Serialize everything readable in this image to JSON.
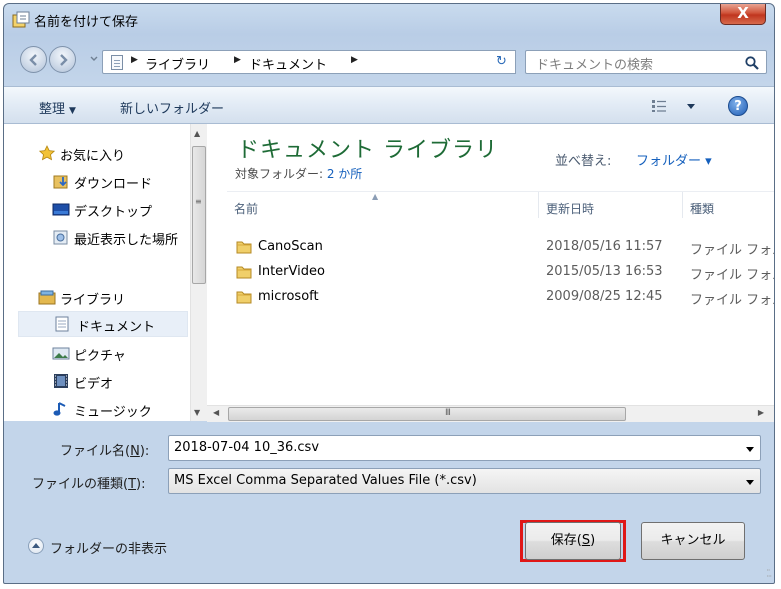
{
  "window": {
    "title": "名前を付けて保存",
    "close_glyph": "X"
  },
  "address": {
    "crumbs": [
      "ライブラリ",
      "ドキュメント"
    ],
    "search_placeholder": "ドキュメントの検索"
  },
  "toolbar": {
    "organize": "整理",
    "new_folder": "新しいフォルダー"
  },
  "navpane": {
    "items": [
      {
        "label": "お気に入り",
        "icon": "star-icon"
      },
      {
        "label": "ダウンロード",
        "icon": "download-folder-icon"
      },
      {
        "label": "デスクトップ",
        "icon": "desktop-icon"
      },
      {
        "label": "最近表示した場所",
        "icon": "recent-places-icon"
      },
      {
        "label": "ライブラリ",
        "icon": "library-icon"
      },
      {
        "label": "ドキュメント",
        "icon": "document-icon"
      },
      {
        "label": "ピクチャ",
        "icon": "picture-icon"
      },
      {
        "label": "ビデオ",
        "icon": "video-icon"
      },
      {
        "label": "ミュージック",
        "icon": "music-icon"
      }
    ]
  },
  "content": {
    "library_title": "ドキュメント ライブラリ",
    "target_prefix": "対象フォルダー: ",
    "target_count": "2 か所",
    "sort_label": "並べ替え:",
    "sort_value": "フォルダー ▾",
    "columns": [
      "名前",
      "更新日時",
      "種類"
    ],
    "files": [
      {
        "name": "CanoScan",
        "modified": "2018/05/16 11:57",
        "type": "ファイル フォルダー"
      },
      {
        "name": "InterVideo",
        "modified": "2015/05/13 16:53",
        "type": "ファイル フォルダー"
      },
      {
        "name": "microsoft",
        "modified": "2009/08/25 12:45",
        "type": "ファイル フォルダー"
      }
    ]
  },
  "form": {
    "filename_label": "ファイル名(",
    "filename_key": "N",
    "filename_tail": "):",
    "filename_value": "2018-07-04 10_36.csv",
    "filetype_label": "ファイルの種類(",
    "filetype_key": "T",
    "filetype_tail": "):",
    "filetype_value": "MS Excel Comma Separated Values File (*.csv)"
  },
  "footer": {
    "hide_folders": "フォルダーの非表示",
    "save_label": "保存(",
    "save_key": "S",
    "save_tail": ")",
    "cancel_label": "キャンセル"
  },
  "colors": {
    "highlight_outline": "#e01717",
    "library_title": "#1e6b36",
    "link": "#1560bd"
  }
}
